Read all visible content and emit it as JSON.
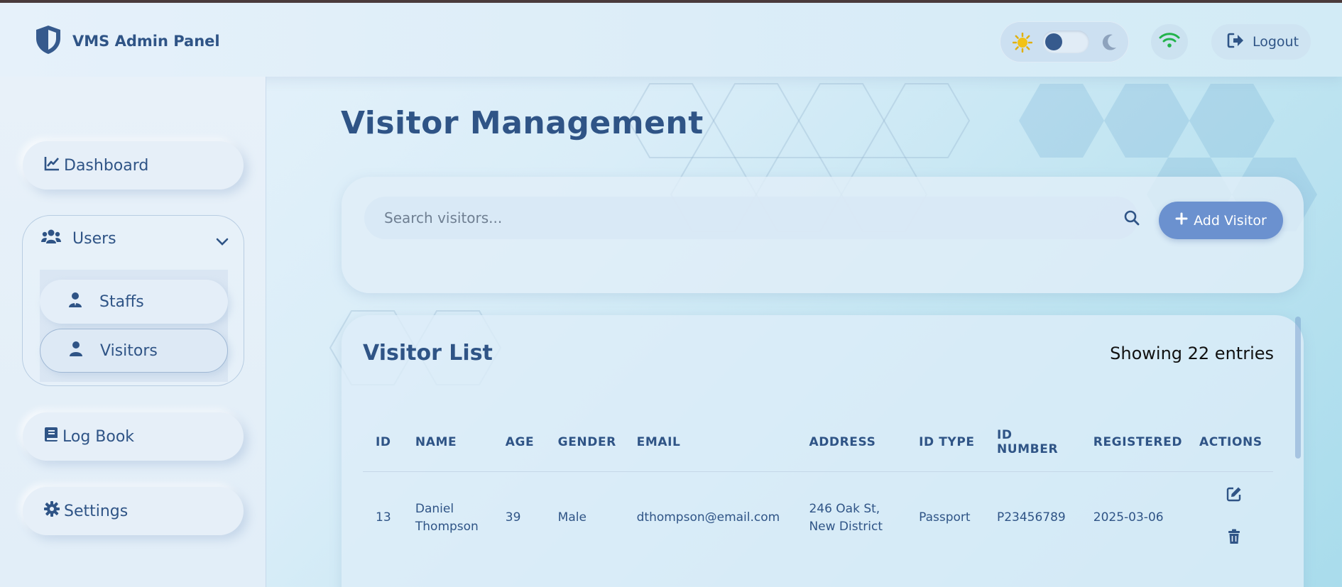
{
  "header": {
    "brand_title": "VMS Admin Panel",
    "logout_label": "Logout"
  },
  "sidebar": {
    "dashboard_label": "Dashboard",
    "users_label": "Users",
    "staffs_label": "Staffs",
    "visitors_label": "Visitors",
    "logbook_label": "Log Book",
    "settings_label": "Settings"
  },
  "main": {
    "page_title": "Visitor Management",
    "search_placeholder": "Search visitors...",
    "add_button_label": "Add Visitor",
    "list_title": "Visitor List",
    "entries_text": "Showing 22 entries"
  },
  "table": {
    "headers": {
      "id": "ID",
      "name": "NAME",
      "age": "AGE",
      "gender": "GENDER",
      "email": "EMAIL",
      "address": "ADDRESS",
      "id_type": "ID TYPE",
      "id_number_1": "ID",
      "id_number_2": "NUMBER",
      "registered": "REGISTERED",
      "actions": "ACTIONS"
    },
    "rows": [
      {
        "id": "13",
        "name_1": "Daniel",
        "name_2": "Thompson",
        "age": "39",
        "gender": "Male",
        "email": "dthompson@email.com",
        "address_1": "246 Oak St,",
        "address_2": "New District",
        "id_type": "Passport",
        "id_number": "P23456789",
        "registered": "2025-03-06"
      }
    ]
  },
  "colors": {
    "primary": "#2f5486",
    "accent_button": "#6b91cf",
    "wifi_green": "#22b34a",
    "sun_yellow": "#f2c216"
  }
}
